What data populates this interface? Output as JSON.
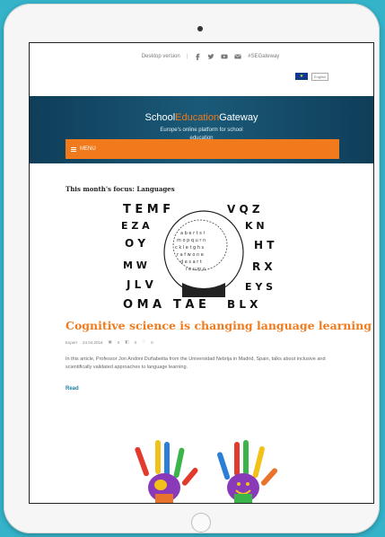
{
  "topbar": {
    "desktop_label": "Desktop version",
    "separator": "|",
    "icons": [
      "facebook-icon",
      "twitter-icon",
      "youtube-icon",
      "mail-icon"
    ],
    "extra_label": "#SEGateway"
  },
  "language": {
    "flag_symbol": "★",
    "selector_label": "English"
  },
  "banner": {
    "title_part1": "School",
    "title_part2": "Education",
    "title_part3": "Gateway",
    "subtitle_line1": "Europe's online platform for school",
    "subtitle_line2": "education"
  },
  "menu": {
    "label": "MENU"
  },
  "focus": {
    "heading": "This month's focus: Languages"
  },
  "article": {
    "title": "Cognitive science is changing language learning",
    "meta_type": "Expert",
    "meta_date": "24.04.2018",
    "meta_stat1": "0",
    "meta_stat2": "0",
    "meta_stat3": "0",
    "body": "In this article, Professor Jon Andoni Duñabeitia from the Universidad Nebrija in Madrid, Spain, talks about inclusive and scientifically validated approaches to language learning.",
    "read_label": "Read"
  },
  "colors": {
    "accent": "#f07a1c",
    "banner": "#0f3e59",
    "link": "#1c7fa6",
    "frame_background": "#34b3c9"
  }
}
